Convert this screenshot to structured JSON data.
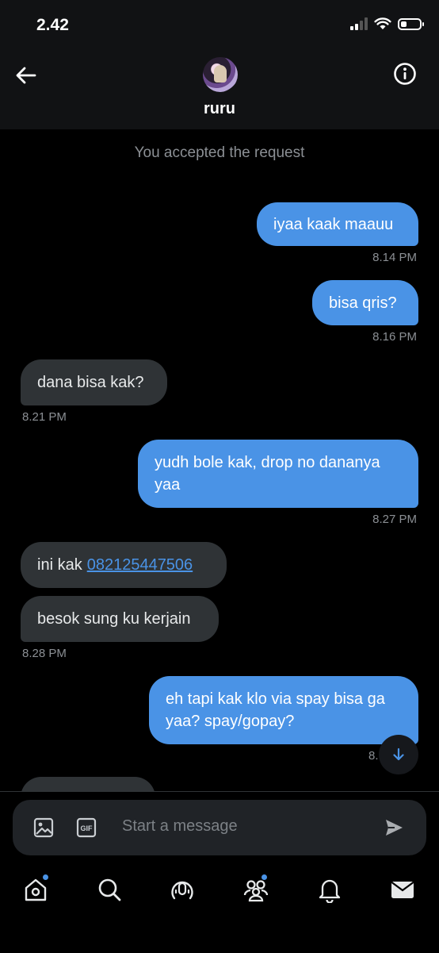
{
  "status_bar": {
    "time": "2.42",
    "battery_level": 0.3
  },
  "header": {
    "contact_name": "ruru",
    "back_icon": "arrow-left-icon",
    "info_icon": "info-icon"
  },
  "conversation": {
    "system_message": "You accepted the request",
    "messages": [
      {
        "direction": "out",
        "text": "iyaa kaak maauu",
        "time": "8.14 PM"
      },
      {
        "direction": "out",
        "text": "bisa qris?",
        "time": "8.16 PM"
      },
      {
        "direction": "in",
        "text": "dana bisa kak?",
        "time": "8.21 PM"
      },
      {
        "direction": "out",
        "text_line1": "yudh bole kak, drop no dananya",
        "text_line2": "yaa",
        "time": "8.27 PM"
      },
      {
        "direction": "in",
        "text": "ini kak",
        "link": "082125447506"
      },
      {
        "direction": "in",
        "text": "besok sung ku kerjain",
        "time": "8.28 PM"
      },
      {
        "direction": "out",
        "text_line1": "eh tapi kak klo via spay bisa ga",
        "text_line2": "yaa? spay/gopay?",
        "time_partial": "8."
      }
    ]
  },
  "composer": {
    "placeholder": "Start a message",
    "gif_label": "GIF"
  },
  "nav": {
    "items": [
      "home-icon",
      "search-icon",
      "spaces-icon",
      "communities-icon",
      "notifications-icon",
      "messages-icon"
    ]
  },
  "colors": {
    "accent": "#4a93e6",
    "incoming_bubble": "#2f3336",
    "background": "#000000"
  }
}
